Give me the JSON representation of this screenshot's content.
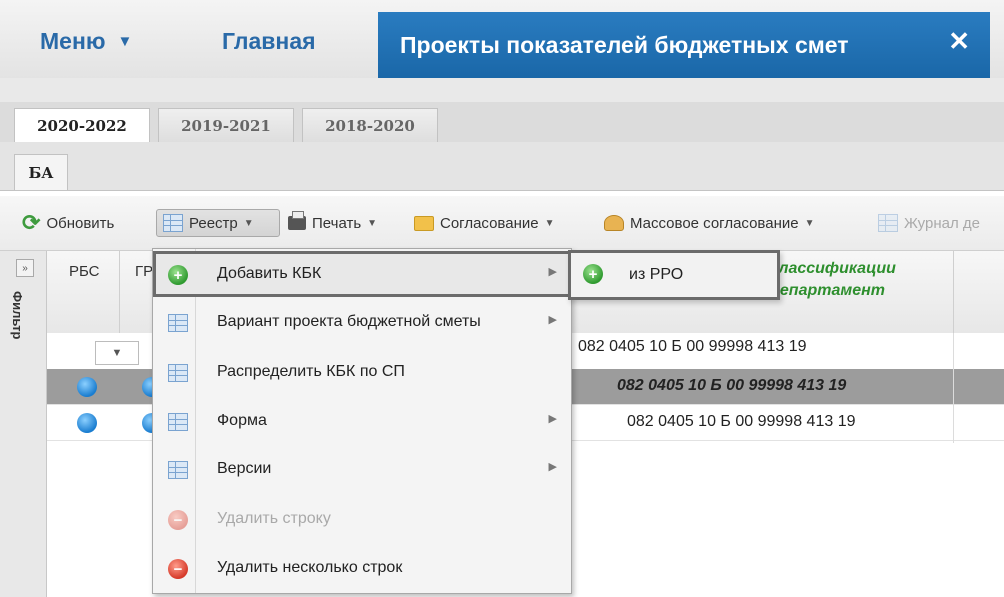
{
  "topbar": {
    "menu_label": "Меню",
    "home_label": "Главная",
    "active_tab_title": "Проекты показателей бюджетных смет",
    "close_symbol": "✕"
  },
  "year_tabs": [
    {
      "label": "2020-2022",
      "active": true
    },
    {
      "label": "2019-2021",
      "active": false
    },
    {
      "label": "2018-2020",
      "active": false
    }
  ],
  "ba_tab": {
    "label": "БА"
  },
  "toolbar": {
    "refresh": "Обновить",
    "registry": "Реестр",
    "print": "Печать",
    "approval": "Согласование",
    "mass_approval": "Массовое согласование",
    "journal": "Журнал де"
  },
  "filter_panel": {
    "label": "Фильтр",
    "expand_symbol": "»"
  },
  "grid": {
    "columns": {
      "rbs": "РБС",
      "gr": "ГР"
    },
    "kbk_header_line1": "классификации",
    "kbk_header_line2": "департамент",
    "filter_kbk": "082 0405 10 Б 00 99998 413 19",
    "rows": [
      {
        "kbk": "082 0405 10 Б 00 99998 413 19",
        "selected": true
      },
      {
        "kbk": "082 0405 10 Б 00 99998 413 19",
        "selected": false
      }
    ]
  },
  "dropdown": {
    "items": [
      {
        "label": "Добавить КБК",
        "has_submenu": true,
        "icon": "add-circle-icon",
        "active": true
      },
      {
        "label": "Вариант проекта бюджетной сметы",
        "has_submenu": true,
        "icon": "grid-icon"
      },
      {
        "label": "Распределить КБК по СП",
        "has_submenu": false,
        "icon": "grid-icon"
      },
      {
        "label": "Форма",
        "has_submenu": true,
        "icon": "grid-icon"
      },
      {
        "label": "Версии",
        "has_submenu": true,
        "icon": "grid-icon"
      },
      {
        "label": "Удалить строку",
        "has_submenu": false,
        "icon": "delete-circle-icon",
        "disabled": true
      },
      {
        "label": "Удалить несколько строк",
        "has_submenu": false,
        "icon": "delete-circle-icon"
      }
    ],
    "submenu": {
      "label": "из РРО",
      "icon": "add-circle-icon"
    }
  },
  "colors": {
    "accent_blue": "#1a67a8",
    "link_blue": "#2a6aa8",
    "kbk_green": "#2e8f2e",
    "selected_row": "#9c9c9c"
  }
}
